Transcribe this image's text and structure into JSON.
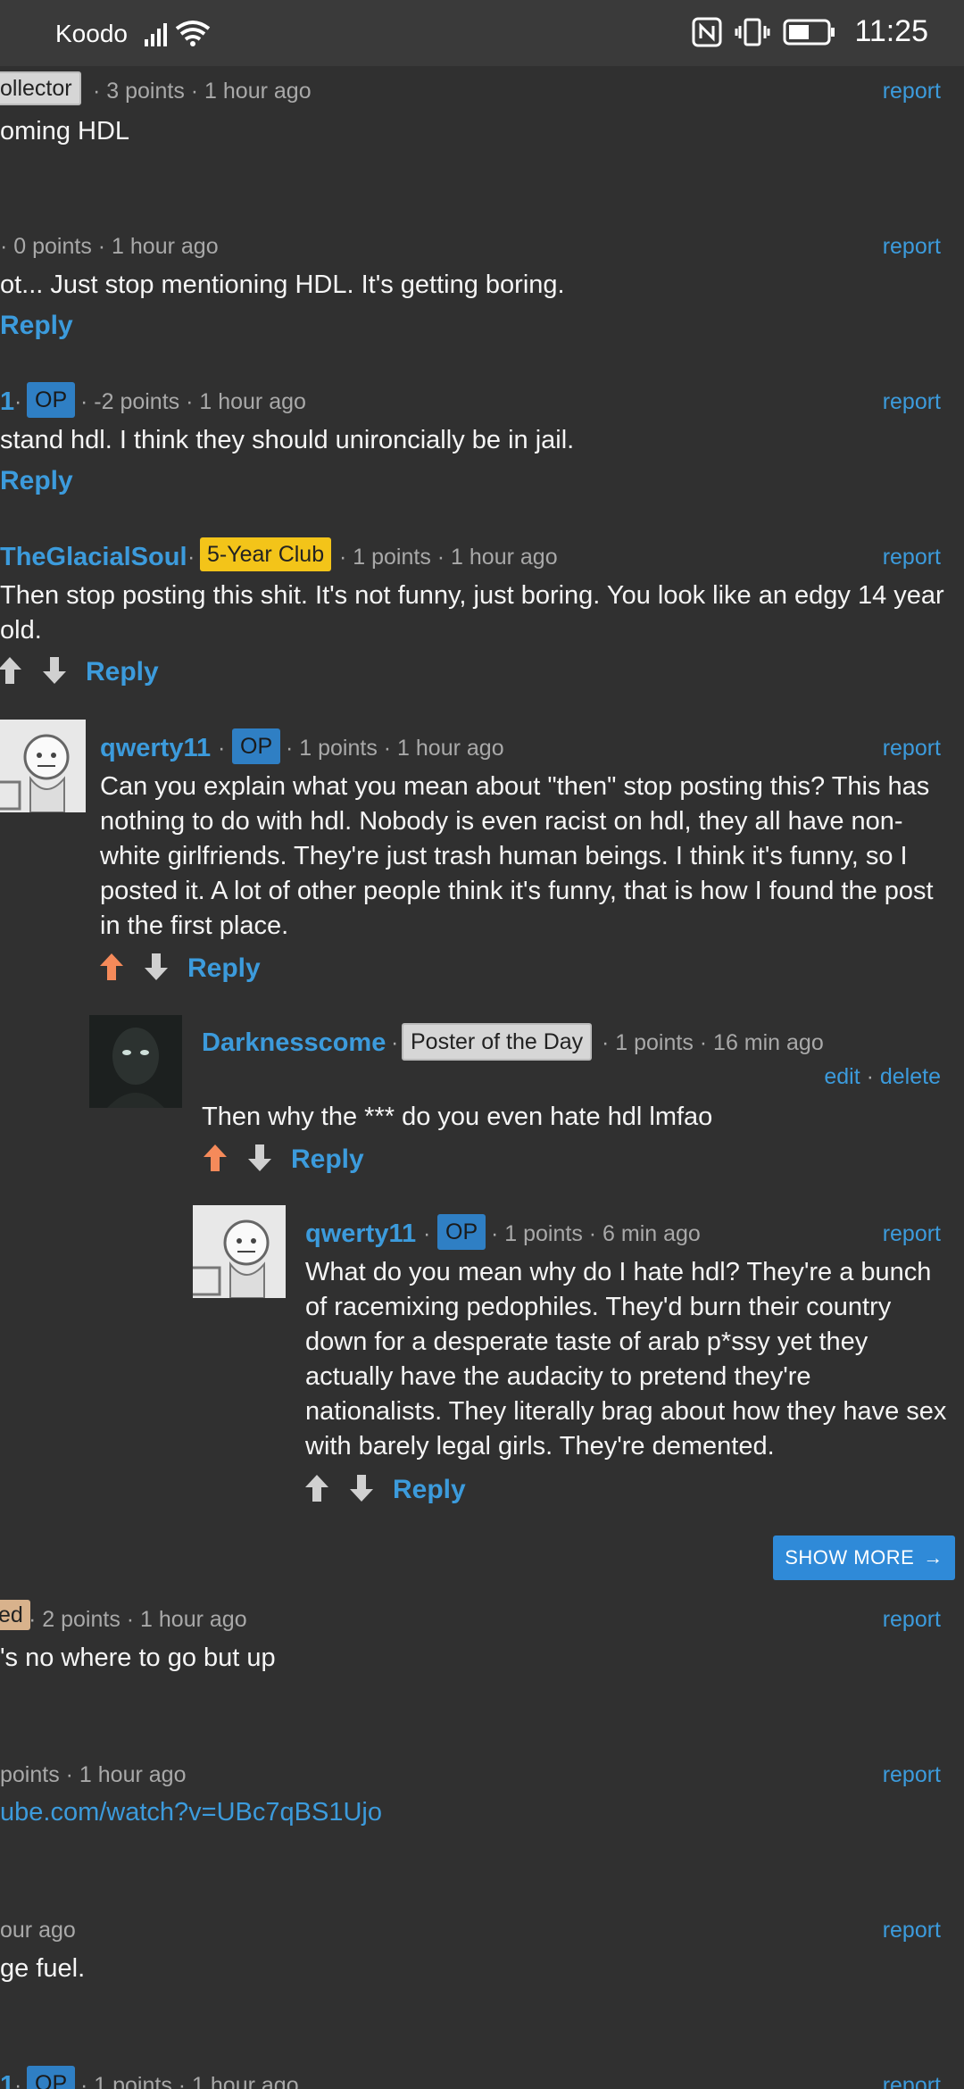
{
  "status_bar": {
    "carrier": "Koodo",
    "time": "11:25",
    "icons": [
      "signal-icon",
      "wifi-icon",
      "nfc-icon",
      "vibrate-icon",
      "battery-icon"
    ]
  },
  "colors": {
    "background": "#303030",
    "accent": "#3c9bdc",
    "upvote_active": "#f58a5a"
  },
  "comments": {
    "c1": {
      "badge": "ollector",
      "meta": "· 3 points · 1 hour ago",
      "report": "report",
      "text": "oming HDL"
    },
    "c2": {
      "meta": "· 0 points · 1 hour ago",
      "report": "report",
      "text": "ot... Just stop mentioning HDL. It's getting boring.",
      "reply": "Reply"
    },
    "c3": {
      "user": "1",
      "sep": "·",
      "badge": "OP",
      "meta": "· -2 points · 1 hour ago",
      "report": "report",
      "text": "stand hdl. I think they should unironcially be in jail.",
      "reply": "Reply"
    },
    "c4": {
      "user": "TheGlacialSoul",
      "sep": "·",
      "badge": "5-Year Club",
      "meta": "· 1 points · 1 hour ago",
      "report": "report",
      "text": "Then stop posting this shit. It's not funny, just boring. You look like an edgy 14 year old.",
      "reply": "Reply"
    },
    "c5": {
      "user": "qwerty11",
      "sep": "·",
      "badge": "OP",
      "meta": "· 1 points · 1 hour ago",
      "report": "report",
      "text": "Can you explain what you mean about \"then\" stop posting this? This has nothing to do with hdl. Nobody is even racist on hdl, they all have non-white girlfriends. They're just trash human beings. I think it's funny, so I posted it. A lot of other people think it's funny, that is how I found the post in the first place.",
      "reply": "Reply"
    },
    "c6": {
      "user": "Darknesscome",
      "sep": "·",
      "badge": "Poster of the Day",
      "meta": "· 1 points · 16 min ago",
      "edit": "edit",
      "dot": "·",
      "delete": "delete",
      "text": "Then why the *** do you even hate hdl lmfao",
      "reply": "Reply"
    },
    "c7": {
      "user": "qwerty11",
      "sep": "·",
      "badge": "OP",
      "meta": "· 1 points · 6 min ago",
      "report": "report",
      "text": "What do you mean why do I hate hdl? They're a bunch of racemixing pedophiles. They'd burn their country down for a desperate taste of arab p*ssy yet they actually have the audacity to pretend they're nationalists. They literally brag about how they have sex with barely legal girls. They're demented.",
      "reply": "Reply"
    },
    "show_more": "SHOW MORE",
    "show_more_arrow": "→",
    "c8": {
      "badge": "ed",
      "meta": "· 2 points · 1 hour ago",
      "report": "report",
      "text": "'s no where to go but up"
    },
    "c9": {
      "meta": "points · 1 hour ago",
      "report": "report",
      "link": "ube.com/watch?v=UBc7qBS1Ujo"
    },
    "c10": {
      "meta": "our ago",
      "report": "report",
      "text": "ge fuel."
    },
    "c11": {
      "user": "1",
      "sep": "·",
      "badge": "OP",
      "meta": "· 1 points · 1 hour ago",
      "report": "report"
    }
  }
}
